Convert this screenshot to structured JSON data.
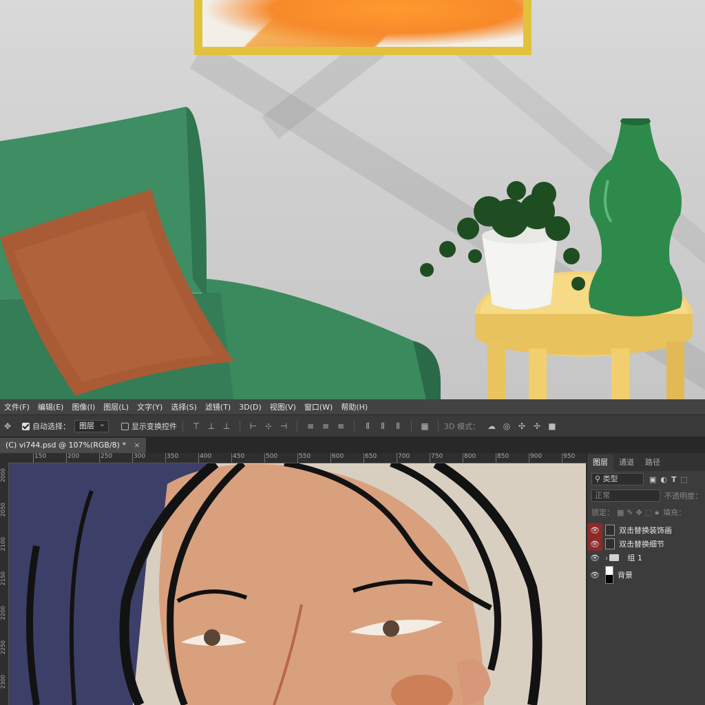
{
  "menu": [
    "文件(F)",
    "编辑(E)",
    "图像(I)",
    "图层(L)",
    "文字(Y)",
    "选择(S)",
    "滤镜(T)",
    "3D(D)",
    "视图(V)",
    "窗口(W)",
    "帮助(H)"
  ],
  "options": {
    "auto_select_label": "自动选择：",
    "auto_select_value": "图层",
    "show_transform_label": "显示变换控件",
    "mode_3d_label": "3D 模式："
  },
  "document_tab": "(C) vi744.psd @ 107%(RGB/8) *",
  "ruler_h": [
    "150",
    "200",
    "250",
    "300",
    "350",
    "400",
    "450",
    "500",
    "550",
    "600",
    "650",
    "700",
    "750",
    "800",
    "850",
    "900",
    "950"
  ],
  "ruler_v": [
    "2000",
    "2050",
    "2100",
    "2150",
    "2200",
    "2250",
    "2300"
  ],
  "panel": {
    "tabs": [
      "图层",
      "通道",
      "路径"
    ],
    "filter_label": "类型",
    "blend_mode": "正常",
    "opacity_label": "不透明度：",
    "lock_label": "锁定：",
    "fill_label": "填充：",
    "layers": [
      {
        "name": "双击替换装饰画",
        "kind": "smart",
        "eye_highlight": true
      },
      {
        "name": "双击替换细节",
        "kind": "smart",
        "eye_highlight": true
      },
      {
        "name": "组 1",
        "kind": "group",
        "eye_highlight": false
      },
      {
        "name": "背景",
        "kind": "background",
        "eye_highlight": false
      }
    ]
  },
  "colors": {
    "sofa": "#3d8a5e",
    "pillow": "#a85a34",
    "table": "#f0cd6a",
    "vase": "#2f8a4a",
    "frame": "#e2c23c",
    "canvas_hair": "#121212",
    "canvas_bg_navy": "#3c3f68",
    "canvas_skin": "#d9a07e"
  }
}
